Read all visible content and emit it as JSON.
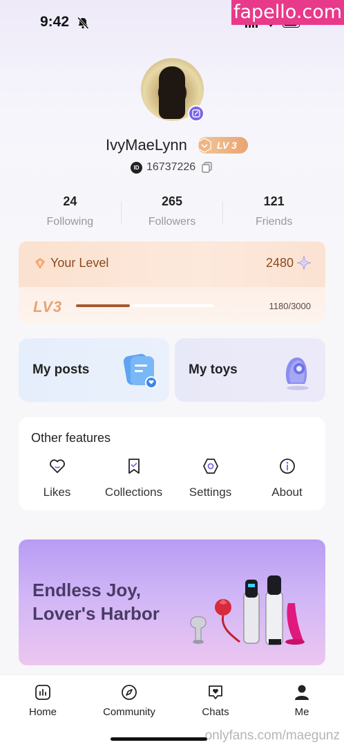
{
  "status_bar": {
    "time": "9:42"
  },
  "watermark_top": "fapello.com",
  "profile": {
    "username": "IvyMaeLynn",
    "level_badge": "LV 3",
    "id_label": "ID",
    "id_value": "16737226"
  },
  "stats": [
    {
      "value": "24",
      "label": "Following"
    },
    {
      "value": "265",
      "label": "Followers"
    },
    {
      "value": "121",
      "label": "Friends"
    }
  ],
  "level_card": {
    "title": "Your Level",
    "points": "2480",
    "level_label": "LV3",
    "progress_text": "1180/3000",
    "progress": 0.39
  },
  "tiles": {
    "posts": "My posts",
    "toys": "My toys"
  },
  "features": {
    "title": "Other features",
    "items": [
      {
        "label": "Likes",
        "icon": "heart-icon"
      },
      {
        "label": "Collections",
        "icon": "bookmark-icon"
      },
      {
        "label": "Settings",
        "icon": "settings-icon"
      },
      {
        "label": "About",
        "icon": "info-icon"
      }
    ]
  },
  "banner": {
    "line1": "Endless Joy,",
    "line2": "Lover's Harbor"
  },
  "bottom_nav": [
    {
      "label": "Home",
      "icon": "home-icon"
    },
    {
      "label": "Community",
      "icon": "compass-icon"
    },
    {
      "label": "Chats",
      "icon": "chat-icon"
    },
    {
      "label": "Me",
      "icon": "person-icon"
    }
  ],
  "watermark_bottom": "onlyfans.com/maegunz",
  "colors": {
    "accent": "#7b63e8",
    "level_text": "#8a4a1e",
    "progress": "#a8582e"
  }
}
